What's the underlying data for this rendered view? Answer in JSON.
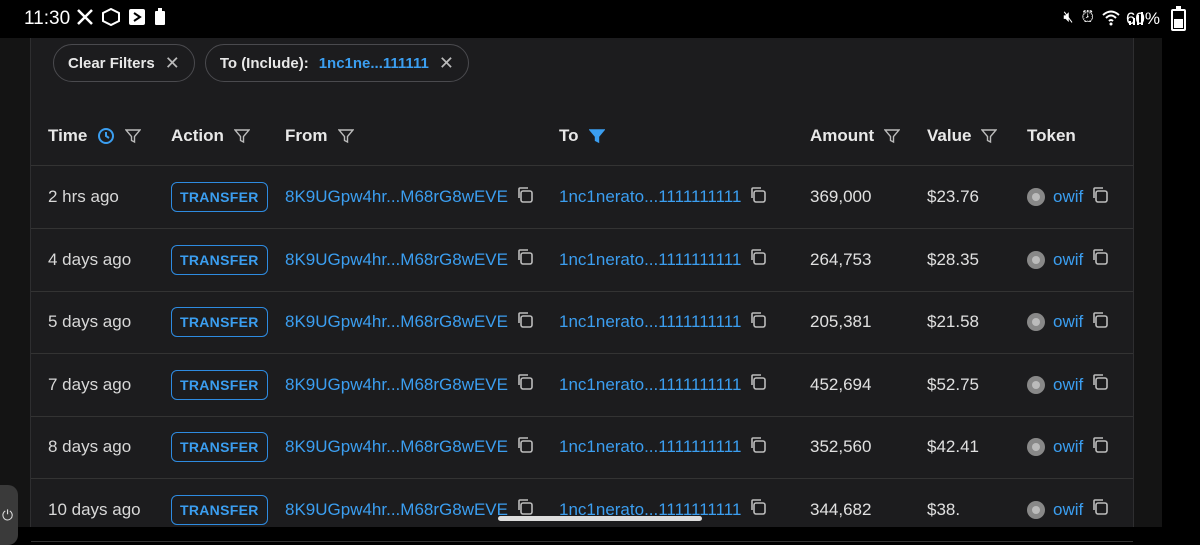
{
  "status_bar": {
    "time": "11:30",
    "battery": "60%"
  },
  "filters": {
    "clear_label": "Clear Filters",
    "to_label": "To (Include):",
    "to_value": "1nc1ne...111111"
  },
  "columns": {
    "time": "Time",
    "action": "Action",
    "from": "From",
    "to": "To",
    "amount": "Amount",
    "value": "Value",
    "token": "Token"
  },
  "rows": [
    {
      "time": "2 hrs ago",
      "action": "TRANSFER",
      "from": "8K9UGpw4hr...M68rG8wEVE",
      "to": "1nc1nerato...1111111111",
      "amount": "369,000",
      "value": "$23.76",
      "token": "owif"
    },
    {
      "time": "4 days ago",
      "action": "TRANSFER",
      "from": "8K9UGpw4hr...M68rG8wEVE",
      "to": "1nc1nerato...1111111111",
      "amount": "264,753",
      "value": "$28.35",
      "token": "owif"
    },
    {
      "time": "5 days ago",
      "action": "TRANSFER",
      "from": "8K9UGpw4hr...M68rG8wEVE",
      "to": "1nc1nerato...1111111111",
      "amount": "205,381",
      "value": "$21.58",
      "token": "owif"
    },
    {
      "time": "7 days ago",
      "action": "TRANSFER",
      "from": "8K9UGpw4hr...M68rG8wEVE",
      "to": "1nc1nerato...1111111111",
      "amount": "452,694",
      "value": "$52.75",
      "token": "owif"
    },
    {
      "time": "8 days ago",
      "action": "TRANSFER",
      "from": "8K9UGpw4hr...M68rG8wEVE",
      "to": "1nc1nerato...1111111111",
      "amount": "352,560",
      "value": "$42.41",
      "token": "owif"
    },
    {
      "time": "10 days ago",
      "action": "TRANSFER",
      "from": "8K9UGpw4hr...M68rG8wEVE",
      "to": "1nc1nerato...1111111111",
      "amount": "344,682",
      "value": "$38.",
      "token": "owif"
    }
  ],
  "colors": {
    "accent": "#3b9ef0",
    "panel": "#1c1c1e",
    "border": "#333333"
  }
}
